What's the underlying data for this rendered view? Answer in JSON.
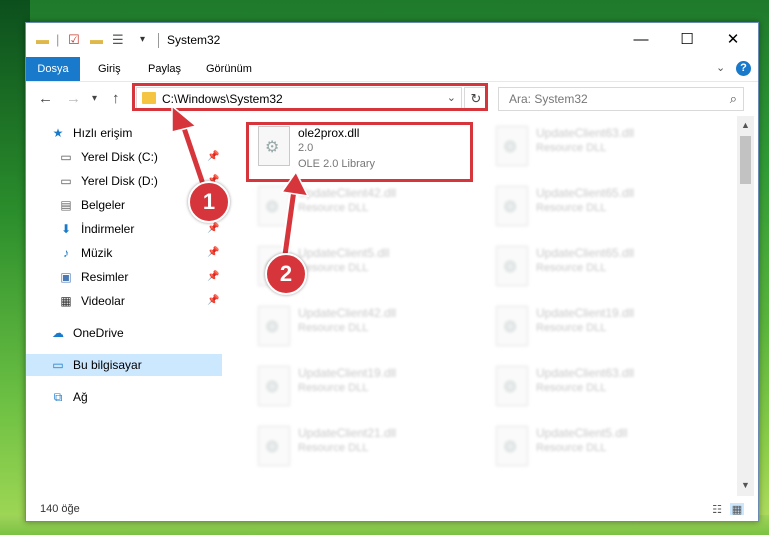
{
  "window": {
    "title": "System32",
    "controls": {
      "minimize": "—",
      "maximize": "☐",
      "close": "✕"
    }
  },
  "ribbon": {
    "tabs": [
      "Dosya",
      "Giriş",
      "Paylaş",
      "Görünüm"
    ],
    "help": "?"
  },
  "nav": {
    "address": "C:\\Windows\\System32",
    "search_placeholder": "Ara: System32"
  },
  "sidebar": {
    "items": [
      {
        "label": "Hızlı erişim",
        "icon": "star-icon",
        "pinned": false
      },
      {
        "label": "Yerel Disk (C:)",
        "icon": "drive-icon",
        "pinned": true
      },
      {
        "label": "Yerel Disk (D:)",
        "icon": "drive-icon",
        "pinned": true
      },
      {
        "label": "Belgeler",
        "icon": "documents-icon",
        "pinned": true
      },
      {
        "label": "İndirmeler",
        "icon": "download-icon",
        "pinned": true
      },
      {
        "label": "Müzik",
        "icon": "music-icon",
        "pinned": true
      },
      {
        "label": "Resimler",
        "icon": "pictures-icon",
        "pinned": true
      },
      {
        "label": "Videolar",
        "icon": "video-icon",
        "pinned": true
      },
      {
        "label": "OneDrive",
        "icon": "cloud-icon",
        "pinned": false
      },
      {
        "label": "Bu bilgisayar",
        "icon": "computer-icon",
        "pinned": false,
        "selected": true
      },
      {
        "label": "Ağ",
        "icon": "network-icon",
        "pinned": false
      }
    ]
  },
  "files": {
    "highlighted": {
      "name": "ole2prox.dll",
      "version": "2.0",
      "description": "OLE 2.0 Library"
    },
    "left_column": [
      {
        "name": "UpdateClient42.dll",
        "type": "Resource DLL"
      },
      {
        "name": "UpdateClient5.dll",
        "type": "Resource DLL"
      },
      {
        "name": "UpdateClient42.dll",
        "type": "Resource DLL"
      },
      {
        "name": "UpdateClient19.dll",
        "type": "Resource DLL"
      },
      {
        "name": "UpdateClient21.dll",
        "type": "Resource DLL"
      }
    ],
    "right_column": [
      {
        "name": "UpdateClient63.dll",
        "type": "Resource DLL"
      },
      {
        "name": "UpdateClient65.dll",
        "type": "Resource DLL"
      },
      {
        "name": "UpdateClient65.dll",
        "type": "Resource DLL"
      },
      {
        "name": "UpdateClient19.dll",
        "type": "Resource DLL"
      },
      {
        "name": "UpdateClient63.dll",
        "type": "Resource DLL"
      },
      {
        "name": "UpdateClient5.dll",
        "type": "Resource DLL"
      }
    ]
  },
  "status": {
    "item_count": "140 öğe"
  },
  "callouts": [
    "1",
    "2"
  ],
  "colors": {
    "accent": "#1979ca",
    "highlight": "#d6363b",
    "selected": "#cce8ff"
  }
}
